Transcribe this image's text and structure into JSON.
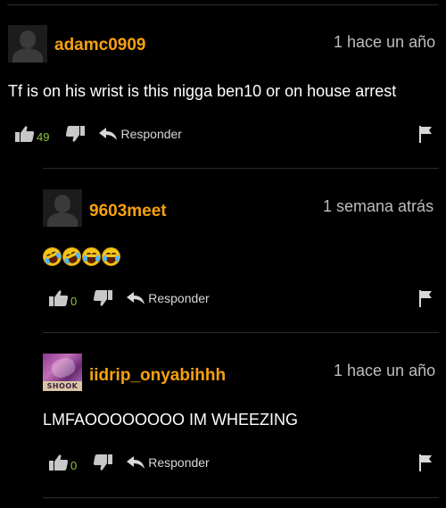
{
  "comments": [
    {
      "username": "adamc0909",
      "timestamp": "1 hace un año",
      "text": "Tf is on his wrist is this nigga ben10 or on house arrest",
      "likes": "49",
      "reply_label": "Responder",
      "avatar": "default-avatar"
    },
    {
      "username": "9603meet",
      "timestamp": "1 semana atrás",
      "emojis": [
        "rolling-on-floor-laughing",
        "rolling-on-floor-laughing",
        "face-with-tears-of-joy",
        "face-with-tears-of-joy"
      ],
      "likes": "0",
      "reply_label": "Responder",
      "avatar": "default-avatar"
    },
    {
      "username": "iidrip_onyabihhh",
      "timestamp": "1 hace un año",
      "text": "LMFAOOOOOOOO IM WHEEZING",
      "likes": "0",
      "reply_label": "Responder",
      "avatar": "photo-avatar",
      "avatar_stamp": "SHOOK"
    }
  ],
  "colors": {
    "background": "#000000",
    "username": "#f7a10f",
    "like_count": "#8cc63f",
    "timestamp": "#bdbdbd"
  }
}
